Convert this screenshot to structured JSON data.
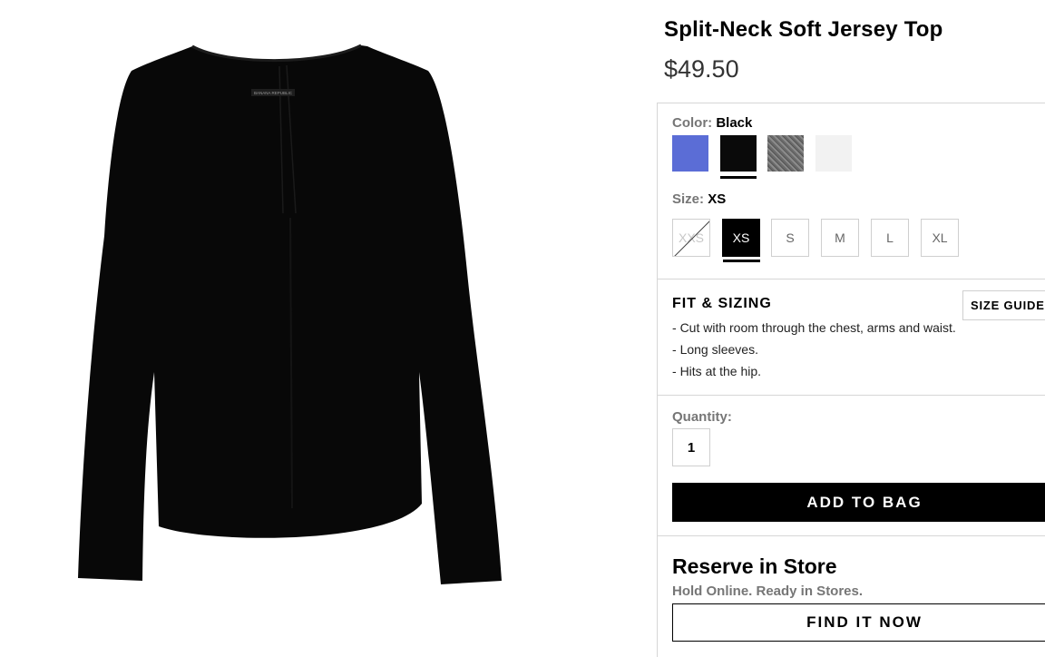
{
  "product": {
    "title": "Split-Neck Soft Jersey Top",
    "price": "$49.50",
    "brand_label": "BANANA REPUBLIC"
  },
  "color": {
    "label": "Color:",
    "selected": "Black",
    "swatches": [
      {
        "name": "blue",
        "hex": "#5b6dd6"
      },
      {
        "name": "black",
        "hex": "#0a0a0a"
      },
      {
        "name": "heather-gray",
        "hex": "#777777"
      },
      {
        "name": "white",
        "hex": "#f2f2f2"
      }
    ]
  },
  "size": {
    "label": "Size:",
    "selected": "XS",
    "options": [
      {
        "label": "XXS",
        "sold_out": true
      },
      {
        "label": "XS",
        "sold_out": false
      },
      {
        "label": "S",
        "sold_out": false
      },
      {
        "label": "M",
        "sold_out": false
      },
      {
        "label": "L",
        "sold_out": false
      },
      {
        "label": "XL",
        "sold_out": false
      }
    ]
  },
  "fit": {
    "heading": "FIT & SIZING",
    "size_guide": "SIZE GUIDE",
    "items": [
      "Cut with room through the chest, arms and waist.",
      "Long sleeves.",
      "Hits at the hip."
    ]
  },
  "quantity": {
    "label": "Quantity:",
    "value": "1"
  },
  "actions": {
    "add_to_bag": "ADD TO BAG"
  },
  "reserve": {
    "title": "Reserve in Store",
    "subtitle": "Hold Online. Ready in Stores.",
    "button": "FIND IT NOW"
  }
}
